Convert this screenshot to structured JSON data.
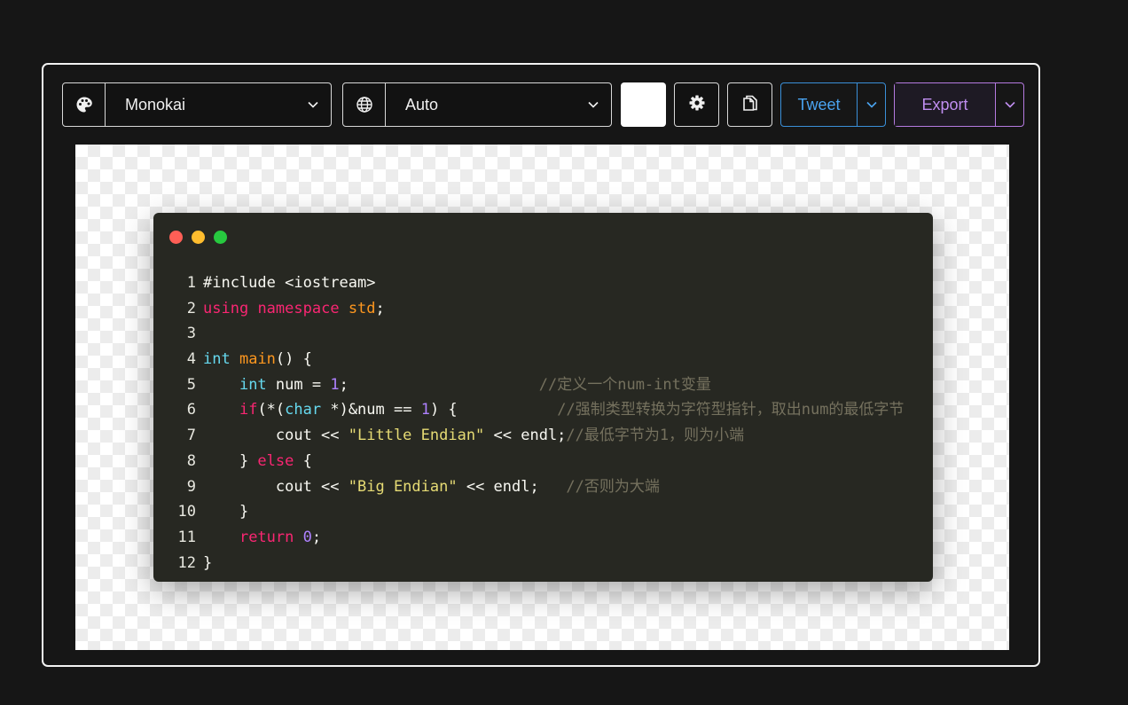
{
  "toolbar": {
    "theme_label": "Monokai",
    "language_label": "Auto",
    "tweet_label": "Tweet",
    "export_label": "Export"
  },
  "icons": {
    "theme": "palette-icon",
    "language": "globe-icon",
    "settings": "gear-icon",
    "copy": "copy-file-icon",
    "dropdown": "chevron-down-icon"
  },
  "colors": {
    "tweet_accent": "#3a8fd8",
    "export_accent": "#b57ae0",
    "window_bg": "#272822",
    "dot_red": "#ff5f56",
    "dot_yellow": "#ffbd2e",
    "dot_green": "#27c93f"
  },
  "code": {
    "line_numbers": [
      "1",
      "2",
      "3",
      "4",
      "5",
      "6",
      "7",
      "8",
      "9",
      "10",
      "11",
      "12"
    ],
    "lines": [
      [
        {
          "t": "#include <iostream>",
          "c": ""
        }
      ],
      [
        {
          "t": "using",
          "c": "kw"
        },
        {
          "t": " ",
          "c": ""
        },
        {
          "t": "namespace",
          "c": "kw"
        },
        {
          "t": " ",
          "c": ""
        },
        {
          "t": "std",
          "c": "fnO"
        },
        {
          "t": ";",
          "c": ""
        }
      ],
      [],
      [
        {
          "t": "int",
          "c": "ty"
        },
        {
          "t": " ",
          "c": ""
        },
        {
          "t": "main",
          "c": "fnO"
        },
        {
          "t": "() {",
          "c": ""
        }
      ],
      [
        {
          "t": "    ",
          "c": ""
        },
        {
          "t": "int",
          "c": "ty"
        },
        {
          "t": " num = ",
          "c": ""
        },
        {
          "t": "1",
          "c": "nu"
        },
        {
          "t": ";                     ",
          "c": ""
        },
        {
          "t": "//定义一个num-int变量",
          "c": "cm"
        }
      ],
      [
        {
          "t": "    ",
          "c": ""
        },
        {
          "t": "if",
          "c": "kw"
        },
        {
          "t": "(*(",
          "c": ""
        },
        {
          "t": "char",
          "c": "ty"
        },
        {
          "t": " *)&num == ",
          "c": ""
        },
        {
          "t": "1",
          "c": "nu"
        },
        {
          "t": ") {           ",
          "c": ""
        },
        {
          "t": "//强制类型转换为字符型指针，取出num的最低字节",
          "c": "cm"
        }
      ],
      [
        {
          "t": "        cout << ",
          "c": ""
        },
        {
          "t": "\"Little Endian\"",
          "c": "st"
        },
        {
          "t": " << endl;",
          "c": ""
        },
        {
          "t": "//最低字节为1，则为小端",
          "c": "cm"
        }
      ],
      [
        {
          "t": "    } ",
          "c": ""
        },
        {
          "t": "else",
          "c": "kw"
        },
        {
          "t": " {",
          "c": ""
        }
      ],
      [
        {
          "t": "        cout << ",
          "c": ""
        },
        {
          "t": "\"Big Endian\"",
          "c": "st"
        },
        {
          "t": " << endl;   ",
          "c": ""
        },
        {
          "t": "//否则为大端",
          "c": "cm"
        }
      ],
      [
        {
          "t": "    }",
          "c": ""
        }
      ],
      [
        {
          "t": "    ",
          "c": ""
        },
        {
          "t": "return",
          "c": "kw"
        },
        {
          "t": " ",
          "c": ""
        },
        {
          "t": "0",
          "c": "nu"
        },
        {
          "t": ";",
          "c": ""
        }
      ],
      [
        {
          "t": "}",
          "c": ""
        }
      ]
    ]
  }
}
